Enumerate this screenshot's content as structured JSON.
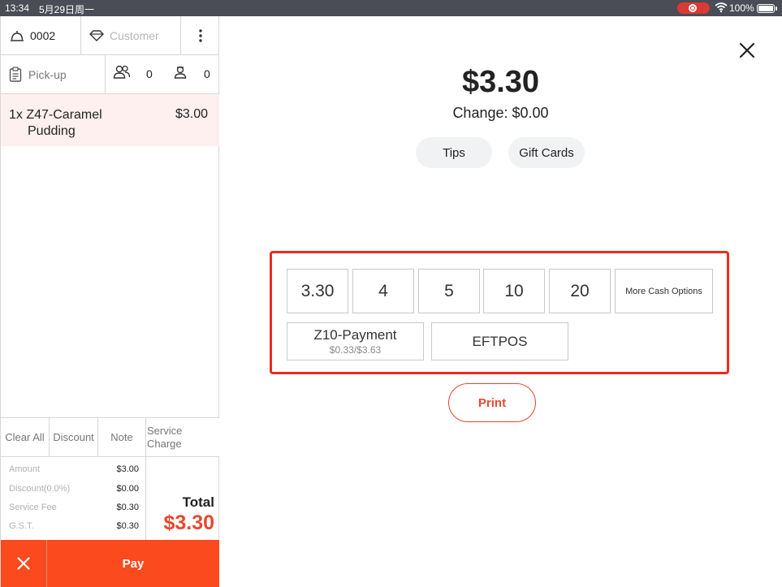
{
  "status_bar": {
    "time": "13:34",
    "date": "5月29日周一",
    "battery": "100%"
  },
  "header": {
    "order_number": "0002",
    "customer_placeholder": "Customer",
    "order_type": "Pick-up",
    "guest_count": "0",
    "staff_count": "0"
  },
  "order_items": [
    {
      "qty_name_line1": "1x Z47-Caramel",
      "name_line2": "Pudding",
      "price": "$3.00"
    }
  ],
  "actions": {
    "clear_all": "Clear All",
    "discount": "Discount",
    "note": "Note",
    "service_charge_line1": "Service",
    "service_charge_line2": "Charge"
  },
  "summary": {
    "amount_label": "Amount",
    "amount_value": "$3.00",
    "discount_label": "Discount(0.0%)",
    "discount_value": "$0.00",
    "service_fee_label": "Service Fee",
    "service_fee_value": "$0.30",
    "gst_label": "G.S.T.",
    "gst_value": "$0.30",
    "total_label": "Total",
    "total_value": "$3.30"
  },
  "footer": {
    "pay_label": "Pay"
  },
  "payment": {
    "amount_due": "$3.30",
    "change": "Change: $0.00",
    "tips_label": "Tips",
    "gift_cards_label": "Gift Cards",
    "cash_options": [
      "3.30",
      "4",
      "5",
      "10",
      "20"
    ],
    "more_cash_label": "More Cash Options",
    "method1_name": "Z10-Payment",
    "method1_sub": "$0.33/$3.63",
    "method2_name": "EFTPOS",
    "print_label": "Print"
  },
  "colors": {
    "accent": "#fa4a1e",
    "total_red": "#e8472d",
    "highlight_border": "#ea2b1f",
    "status_bar": "#4a4d55"
  }
}
